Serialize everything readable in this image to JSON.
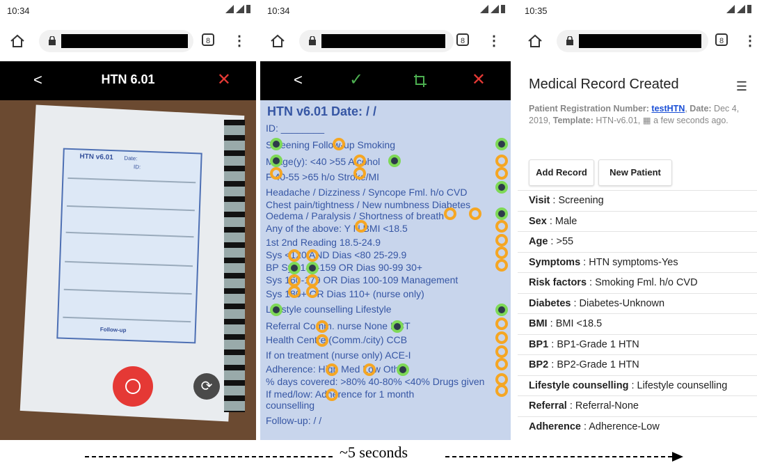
{
  "screens": [
    {
      "time": "10:34",
      "header_title": "HTN 6.01",
      "tab_count": "8",
      "paper": {
        "title": "HTN v6.01",
        "date_label": "Date:",
        "id_label": "ID:",
        "follow_up": "Follow-up"
      }
    },
    {
      "time": "10:34",
      "tab_count": "8",
      "scan_lines": [
        "HTN v6.01  Date:   /   /",
        "ID: ________",
        "Screening   Follow-up          Smoking",
        "M    Age(y): <40    >55          Alcohol",
        "F          40-55    >65      h/o Stroke/MI",
        "Headache / Dizziness / Syncope   Fml. h/o CVD",
        "Chest pain/tightness / New numbness   Diabetes",
        "Oedema / Paralysis / Shortness of breath",
        "Any of the above:  Y    N          BMI <18.5",
        "1st   2nd  Reading                 18.5-24.9",
        "Sys <120 AND Dias <80              25-29.9",
        "BP      Sys 140-159 OR Dias 90-99        30+",
        "Sys 160-179 OR Dias 100-109   Management",
        "Sys 180+ OR Dias 110+            (nurse only)",
        "Lifestyle counselling             Lifestyle",
        "Referral    Comm. nurse    None         HCT",
        "Health Centre   (Comm./city)       CCB",
        "If on treatment (nurse only)        ACE-I",
        "Adherence:   High    Med    Low      Other",
        "% days covered: >80%   40-80%   <40%   Drugs given",
        "If med/low:  Adherence               for 1 month",
        "counselling",
        "Follow-up:    /    /"
      ]
    },
    {
      "time": "10:35",
      "tab_count": "8",
      "title": "Medical Record Created",
      "meta": {
        "reg_label": "Patient Registration Number:",
        "reg_value": "testHTN",
        "date_label": "Date:",
        "date_value": "Dec 4, 2019,",
        "template_label": "Template:",
        "template_value": "HTN-v6.01,",
        "time_ago": "a few seconds ago."
      },
      "buttons": {
        "add_record": "Add Record",
        "new_patient": "New Patient"
      },
      "fields": [
        {
          "label": "Visit",
          "value": "Screening"
        },
        {
          "label": "Sex",
          "value": "Male"
        },
        {
          "label": "Age",
          "value": ">55"
        },
        {
          "label": "Symptoms",
          "value": "HTN symptoms-Yes"
        },
        {
          "label": "Risk factors",
          "value": "Smoking Fml. h/o CVD"
        },
        {
          "label": "Diabetes",
          "value": "Diabetes-Unknown"
        },
        {
          "label": "BMI",
          "value": "BMI <18.5"
        },
        {
          "label": "BP1",
          "value": "BP1-Grade 1 HTN"
        },
        {
          "label": "BP2",
          "value": "BP2-Grade 1 HTN"
        },
        {
          "label": "Lifestyle counselling",
          "value": "Lifestyle counselling"
        },
        {
          "label": "Referral",
          "value": "Referral-None"
        },
        {
          "label": "Adherence",
          "value": "Adherence-Low"
        }
      ]
    }
  ],
  "caption": "~5 seconds",
  "colors": {
    "close_red": "#e53935",
    "check_green": "#4caf50",
    "mark_orange": "#f5a623",
    "mark_green": "#7ed957",
    "link_blue": "#1a4fd6"
  }
}
